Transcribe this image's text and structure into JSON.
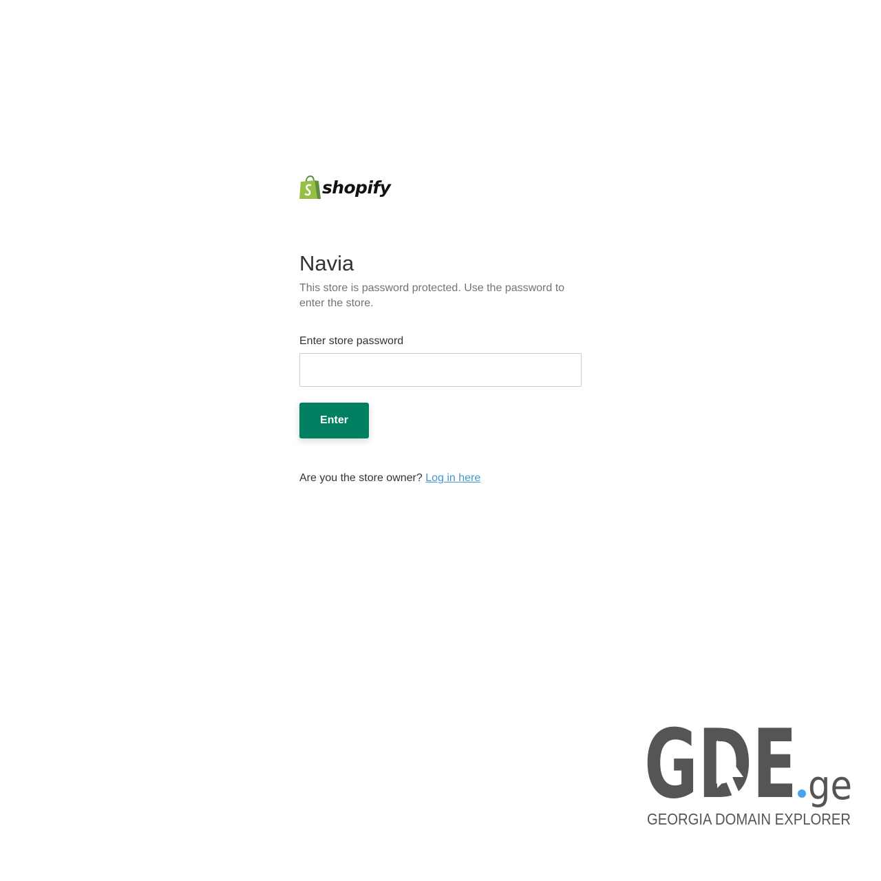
{
  "logo": {
    "icon": "shopify-bag-icon",
    "wordmark": "shopify",
    "brand_color": "#95bf47"
  },
  "store": {
    "name": "Navia",
    "description": "This store is password protected. Use the password to enter the store."
  },
  "form": {
    "label": "Enter store password",
    "password_value": "",
    "submit_label": "Enter",
    "button_color": "#008060"
  },
  "owner": {
    "prompt": "Are you the store owner?",
    "link_text": "Log in here",
    "link_color": "#3d9ad1"
  },
  "watermark": {
    "logo_text": "GDE",
    "tld": ".ge",
    "tagline": "GEORGIA DOMAIN EXPLORER",
    "color": "#555555",
    "dot_color": "#4aa3f0"
  }
}
